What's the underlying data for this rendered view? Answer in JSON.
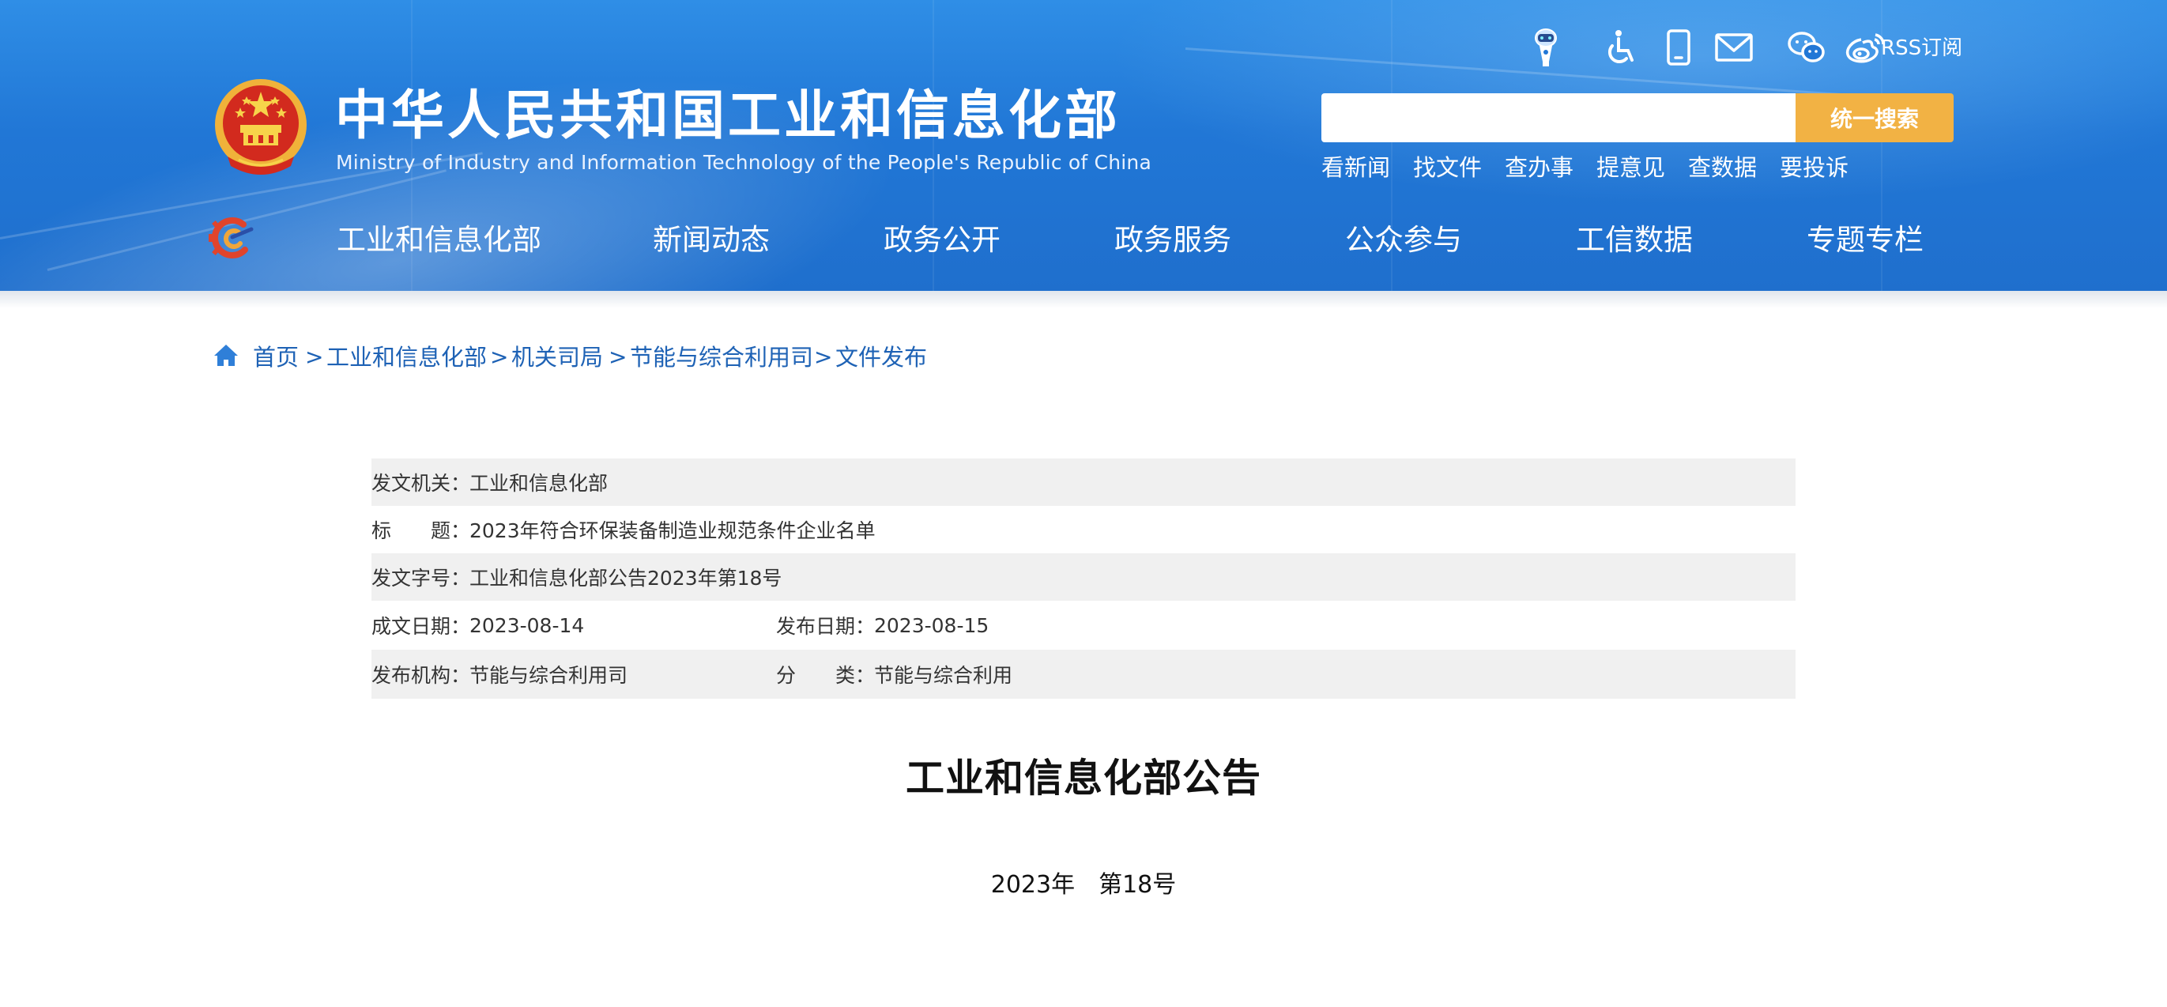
{
  "header": {
    "title_cn": "中华人民共和国工业和信息化部",
    "title_en": "Ministry of Industry and Information Technology of the People's Republic of China",
    "tools": {
      "icons": [
        "robot-assistant-icon",
        "accessibility-icon",
        "mobile-icon",
        "mail-icon",
        "wechat-icon",
        "weibo-icon"
      ],
      "rss_label": "RSS订阅"
    },
    "search": {
      "placeholder": "",
      "button_label": "统一搜索"
    },
    "quick_links": [
      "看新闻",
      "找文件",
      "查办事",
      "提意见",
      "查数据",
      "要投诉"
    ],
    "nav": [
      "工业和信息化部",
      "新闻动态",
      "政务公开",
      "政务服务",
      "公众参与",
      "工信数据",
      "专题专栏"
    ]
  },
  "breadcrumb": {
    "items": [
      "首页",
      "工业和信息化部",
      "机关司局",
      "节能与综合利用司",
      "文件发布"
    ],
    "separator": ">"
  },
  "info": {
    "issuer_label": "发文机关：",
    "issuer_value": "工业和信息化部",
    "title_label": "标　　题：",
    "title_value": "2023年符合环保装备制造业规范条件企业名单",
    "doc_no_label": "发文字号：",
    "doc_no_value": "工业和信息化部公告2023年第18号",
    "written_label": "成文日期：",
    "written_value": "2023-08-14",
    "published_label": "发布日期：",
    "published_value": "2023-08-15",
    "org_label": "发布机构：",
    "org_value": "节能与综合利用司",
    "category_label": "分　　类：",
    "category_value": "节能与综合利用"
  },
  "document": {
    "title": "工业和信息化部公告",
    "number": "2023年　第18号"
  },
  "colors": {
    "header_blue": "#2177d6",
    "search_button": "#f2b244",
    "link_blue": "#1e62b5",
    "row_shade": "#f0f0f0"
  }
}
